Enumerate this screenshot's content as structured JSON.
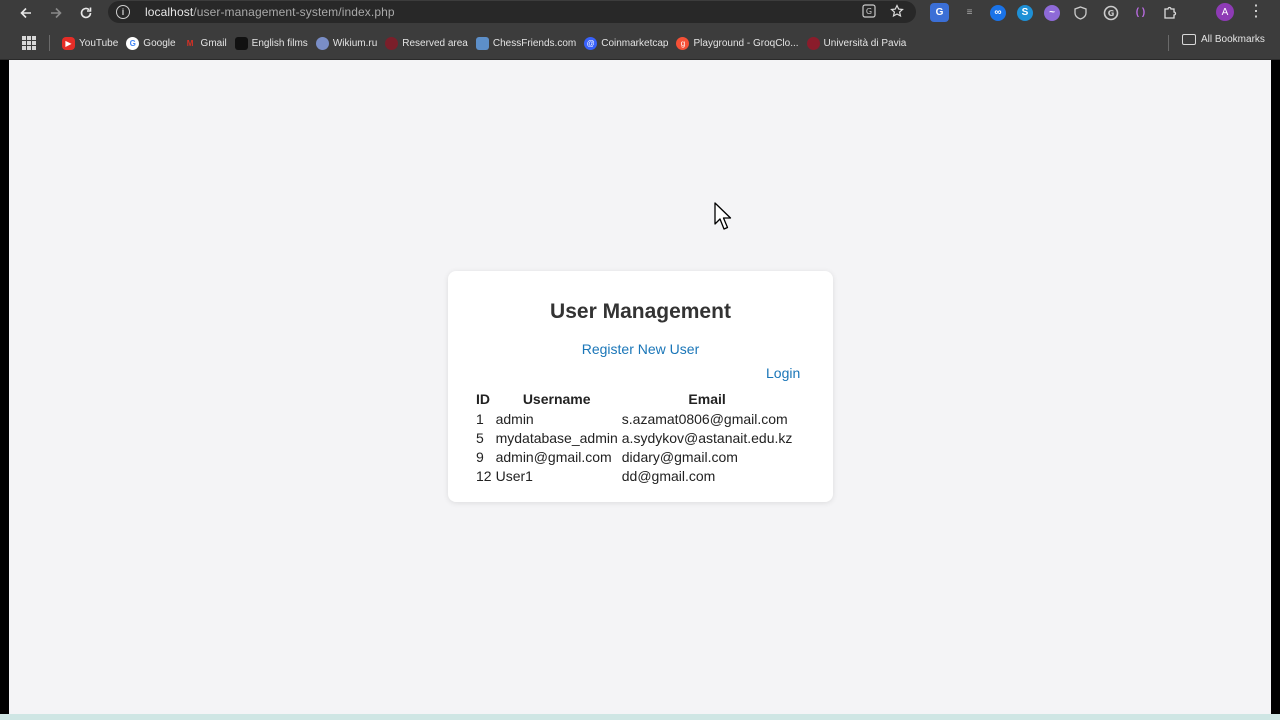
{
  "browser": {
    "url_host": "localhost",
    "url_path": "/user-management-system/index.php",
    "bookmarks": [
      {
        "label": "YouTube",
        "color": "#e52d27"
      },
      {
        "label": "Google",
        "color": "#4285f4"
      },
      {
        "label": "Gmail",
        "color": "#d93025"
      },
      {
        "label": "English films",
        "color": "#111111"
      },
      {
        "label": "Wikium.ru",
        "color": "#7a8ec7"
      },
      {
        "label": "Reserved area",
        "color": "#7a1f2a"
      },
      {
        "label": "ChessFriends.com",
        "color": "#5d8fc9"
      },
      {
        "label": "Coinmarketcap",
        "color": "#3861fb"
      },
      {
        "label": "Playground - GroqClo...",
        "color": "#f55036"
      },
      {
        "label": "Università di Pavia",
        "color": "#8a1c2b"
      }
    ],
    "all_bookmarks_label": "All Bookmarks",
    "profile_initial": "A"
  },
  "page": {
    "title": "User Management",
    "register_link": "Register New User",
    "login_link": "Login",
    "table": {
      "headers": [
        "ID",
        "Username",
        "Email"
      ],
      "rows": [
        [
          "1",
          "admin",
          "s.azamat0806@gmail.com"
        ],
        [
          "5",
          "mydatabase_admin",
          "a.sydykov@astanait.edu.kz"
        ],
        [
          "9",
          "admin@gmail.com",
          "didary@gmail.com"
        ],
        [
          "12",
          "User1",
          "dd@gmail.com"
        ]
      ]
    }
  }
}
